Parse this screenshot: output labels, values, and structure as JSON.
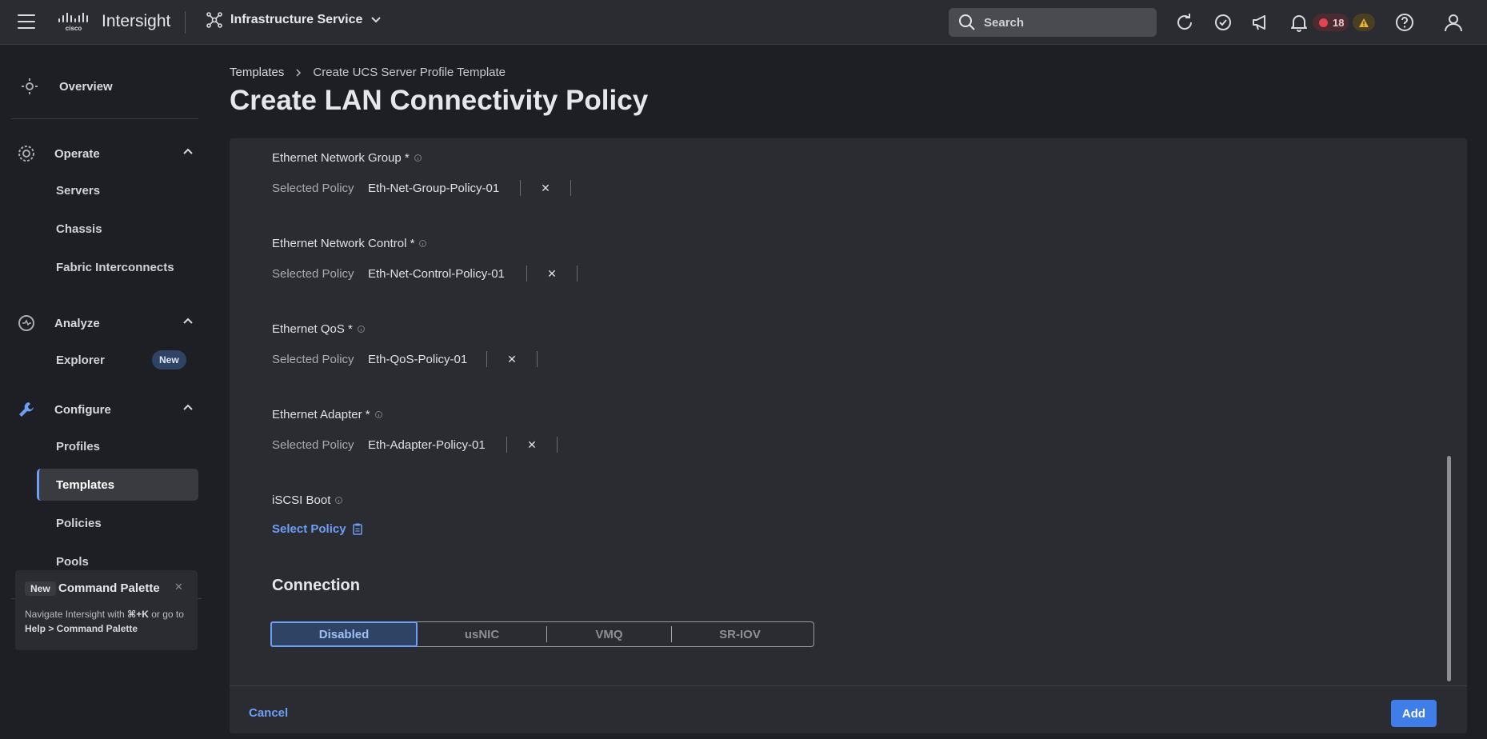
{
  "header": {
    "app_title": "Intersight",
    "service": "Infrastructure Service",
    "search_placeholder": "Search",
    "alarm_count": "18",
    "icons": [
      "menu-icon",
      "cisco-logo",
      "service-icon",
      "chevron-down-icon",
      "search-icon",
      "refresh-icon",
      "check-circle-icon",
      "megaphone-icon",
      "bell-icon",
      "error-icon",
      "warning-icon",
      "help-icon",
      "user-icon"
    ]
  },
  "sidebar": {
    "overview": "Overview",
    "sections": [
      {
        "label": "Operate",
        "items": [
          "Servers",
          "Chassis",
          "Fabric Interconnects"
        ]
      },
      {
        "label": "Analyze",
        "items": [
          "Explorer"
        ],
        "badge": "New"
      },
      {
        "label": "Configure",
        "items": [
          "Profiles",
          "Templates",
          "Policies",
          "Pools"
        ],
        "active": "Templates"
      }
    ],
    "command_palette": {
      "badge": "New",
      "title": "Command Palette",
      "text_pre": "Navigate Intersight with ",
      "shortcut": "⌘+K",
      "text_mid": " or go to ",
      "path": "Help > Command Palette"
    }
  },
  "breadcrumb": {
    "link": "Templates",
    "current": "Create UCS Server Profile Template"
  },
  "page_title": "Create LAN Connectivity Policy",
  "policies": [
    {
      "label": "Ethernet Network Group *",
      "key": "Selected Policy",
      "value": "Eth-Net-Group-Policy-01"
    },
    {
      "label": "Ethernet Network Control *",
      "key": "Selected Policy",
      "value": "Eth-Net-Control-Policy-01"
    },
    {
      "label": "Ethernet QoS *",
      "key": "Selected Policy",
      "value": "Eth-QoS-Policy-01"
    },
    {
      "label": "Ethernet Adapter *",
      "key": "Selected Policy",
      "value": "Eth-Adapter-Policy-01"
    }
  ],
  "iscsi": {
    "label": "iSCSI Boot",
    "link": "Select Policy"
  },
  "connection": {
    "title": "Connection",
    "options": [
      "Disabled",
      "usNIC",
      "VMQ",
      "SR-IOV"
    ],
    "selected": "Disabled"
  },
  "footer": {
    "cancel": "Cancel",
    "add": "Add"
  },
  "colors": {
    "accent": "#6e9ff6",
    "primary_button": "#3f7de8",
    "panel": "#2b2c31",
    "background": "#1e1f24"
  }
}
